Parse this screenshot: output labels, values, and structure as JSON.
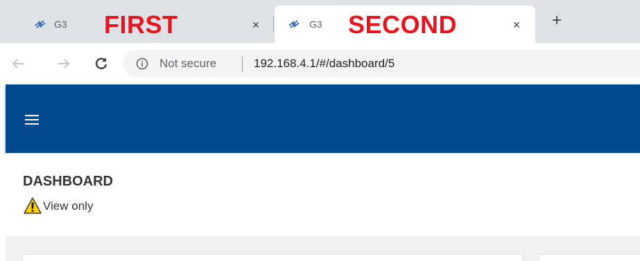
{
  "tabs": [
    {
      "title": "G3",
      "annotation": "FIRST",
      "close": "×"
    },
    {
      "title": "G3",
      "annotation": "SECOND",
      "close": "×"
    }
  ],
  "new_tab": "+",
  "address_bar": {
    "security": "Not secure",
    "url": "192.168.4.1/#/dashboard/5"
  },
  "page": {
    "title": "DASHBOARD",
    "view_mode": "View only"
  },
  "colors": {
    "header": "#014a8f",
    "annotation": "#e8141b",
    "warning": "#ffd200"
  },
  "icons": {
    "favicon": "satellite-icon",
    "back": "arrow-left-icon",
    "forward": "arrow-right-icon",
    "reload": "reload-icon",
    "info": "info-icon",
    "menu": "hamburger-icon",
    "warning": "warning-icon"
  }
}
